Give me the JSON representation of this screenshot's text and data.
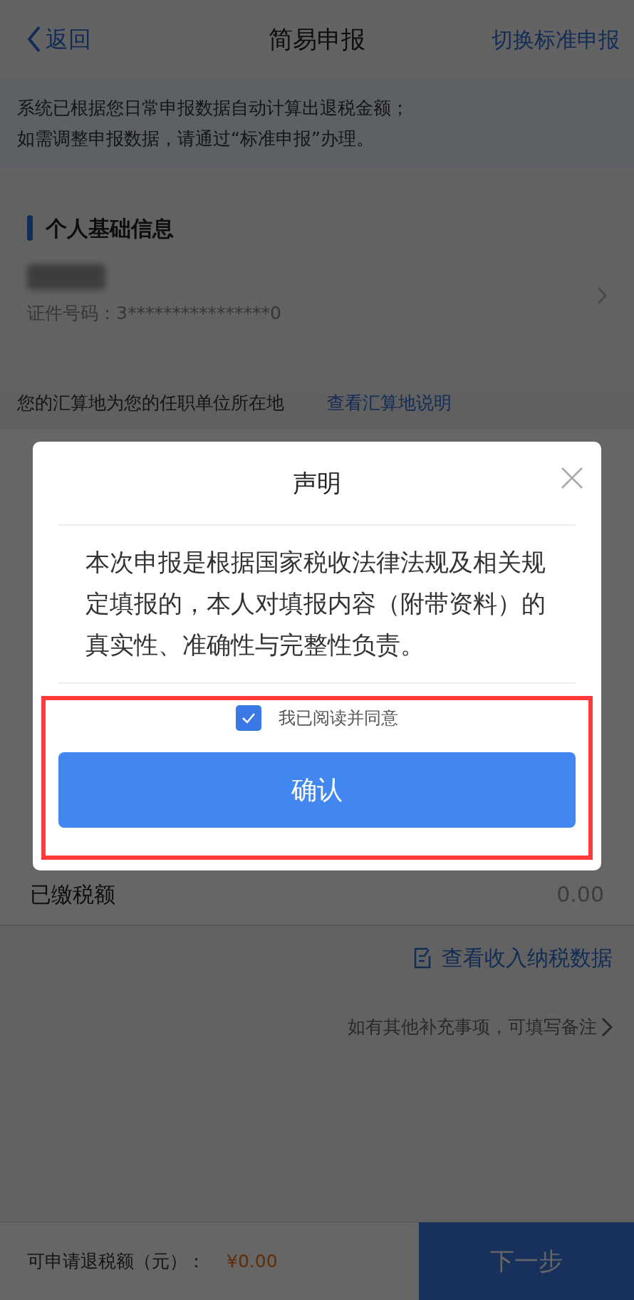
{
  "header": {
    "back": "返回",
    "title": "简易申报",
    "switch_link": "切换标准申报"
  },
  "notice": [
    "系统已根据您日常申报数据自动计算出退税金额；",
    "如需调整申报数据，请通过“标准申报”办理。"
  ],
  "basic_info": {
    "heading": "个人基础信息",
    "id_label": "证件号码：3****************0"
  },
  "location": {
    "text": "您的汇算地为您的任职单位所在地",
    "link": "查看汇算地说明"
  },
  "paid_tax": {
    "label": "已缴税额",
    "value": "0.00"
  },
  "income_link": "查看收入纳税数据",
  "remark_link": "如有其他补充事项，可填写备注",
  "bottom_bar": {
    "label": "可申请退税额（元）：",
    "amount": "¥0.00",
    "next_button": "下一步"
  },
  "modal": {
    "title": "声明",
    "body": "本次申报是根据国家税收法律法规及相关规定填报的，本人对填报内容（附带资料）的真实性、准确性与完整性负责。",
    "agree": {
      "label": "我已阅读并同意",
      "checked": true
    },
    "confirm_button": "确认"
  }
}
